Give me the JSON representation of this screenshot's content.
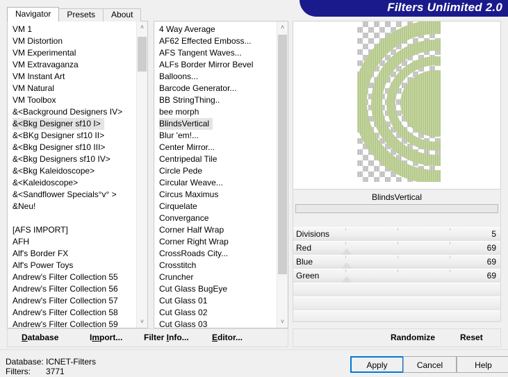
{
  "window": {
    "title": "Filters Unlimited 2.0"
  },
  "tabs": [
    {
      "label": "Navigator",
      "active": true
    },
    {
      "label": "Presets",
      "active": false
    },
    {
      "label": "About",
      "active": false
    }
  ],
  "categories": {
    "selected": "&<Bkg Designer sf10 I>",
    "items": [
      "VM 1",
      "VM Distortion",
      "VM Experimental",
      "VM Extravaganza",
      "VM Instant Art",
      "VM Natural",
      "VM Toolbox",
      "&<Background Designers IV>",
      "&<Bkg Designer sf10 I>",
      "&<BKg Designer sf10 II>",
      "&<Bkg Designer sf10 III>",
      "&<Bkg Designers sf10 IV>",
      "&<Bkg Kaleidoscope>",
      "&<Kaleidoscope>",
      "&<Sandflower Specials°v° >",
      "&Neu!",
      "",
      "[AFS IMPORT]",
      "AFH",
      "Alf's Border FX",
      "Alf's Power Toys",
      "Andrew's Filter Collection 55",
      "Andrew's Filter Collection 56",
      "Andrew's Filter Collection 57",
      "Andrew's Filter Collection 58",
      "Andrew's Filter Collection 59"
    ]
  },
  "filters": {
    "selected": "BlindsVertical",
    "items": [
      "4 Way Average",
      "AF62 Effected Emboss...",
      "AFS Tangent Waves...",
      "ALFs Border Mirror Bevel",
      "Balloons...",
      "Barcode Generator...",
      "BB StringThing..",
      "bee morph",
      "BlindsVertical",
      "Blur 'em!...",
      "Center Mirror...",
      "Centripedal Tile",
      "Circle Pede",
      "Circular Weave...",
      "Circus Maximus",
      "Cirquelate",
      "Convergance",
      "Corner Half Wrap",
      "Corner Right Wrap",
      "CrossRoads City...",
      "Crosstitch",
      "Cruncher",
      "Cut Glass  BugEye",
      "Cut Glass 01",
      "Cut Glass 02",
      "Cut Glass 03"
    ]
  },
  "preview": {
    "alt": "BlindsVertical filter preview: concentric green arcs over transparency checkerboard",
    "arc_color": "#b5c98a",
    "checker_color": "#c0c0c0"
  },
  "params": {
    "title": "BlindsVertical",
    "rows": [
      {
        "label": "Divisions",
        "value": "5",
        "marker": false
      },
      {
        "label": "Red",
        "value": "69",
        "marker": true
      },
      {
        "label": "Blue",
        "value": "69",
        "marker": true
      },
      {
        "label": "Green",
        "value": "69",
        "marker": true
      }
    ]
  },
  "left_actions": [
    {
      "label": "Database",
      "accel": "D",
      "prefix": "",
      "suffix": "atabase"
    },
    {
      "label": "Import...",
      "accel": "m",
      "prefix": "I",
      "suffix": "port..."
    },
    {
      "label": "Filter Info...",
      "accel": "I",
      "prefix": "Filter ",
      "suffix": "nfo..."
    },
    {
      "label": "Editor...",
      "accel": "E",
      "prefix": "",
      "suffix": "ditor..."
    }
  ],
  "right_actions": [
    {
      "label": "Randomize"
    },
    {
      "label": "Reset"
    }
  ],
  "status": {
    "database_label": "Database:",
    "database_value": "ICNET-Filters",
    "filters_label": "Filters:",
    "filters_value": "3771"
  },
  "dialog_buttons": {
    "apply": "Apply",
    "cancel": "Cancel",
    "help": "Help"
  },
  "icons": {
    "scroll_up": "˄",
    "scroll_down": "˅"
  }
}
